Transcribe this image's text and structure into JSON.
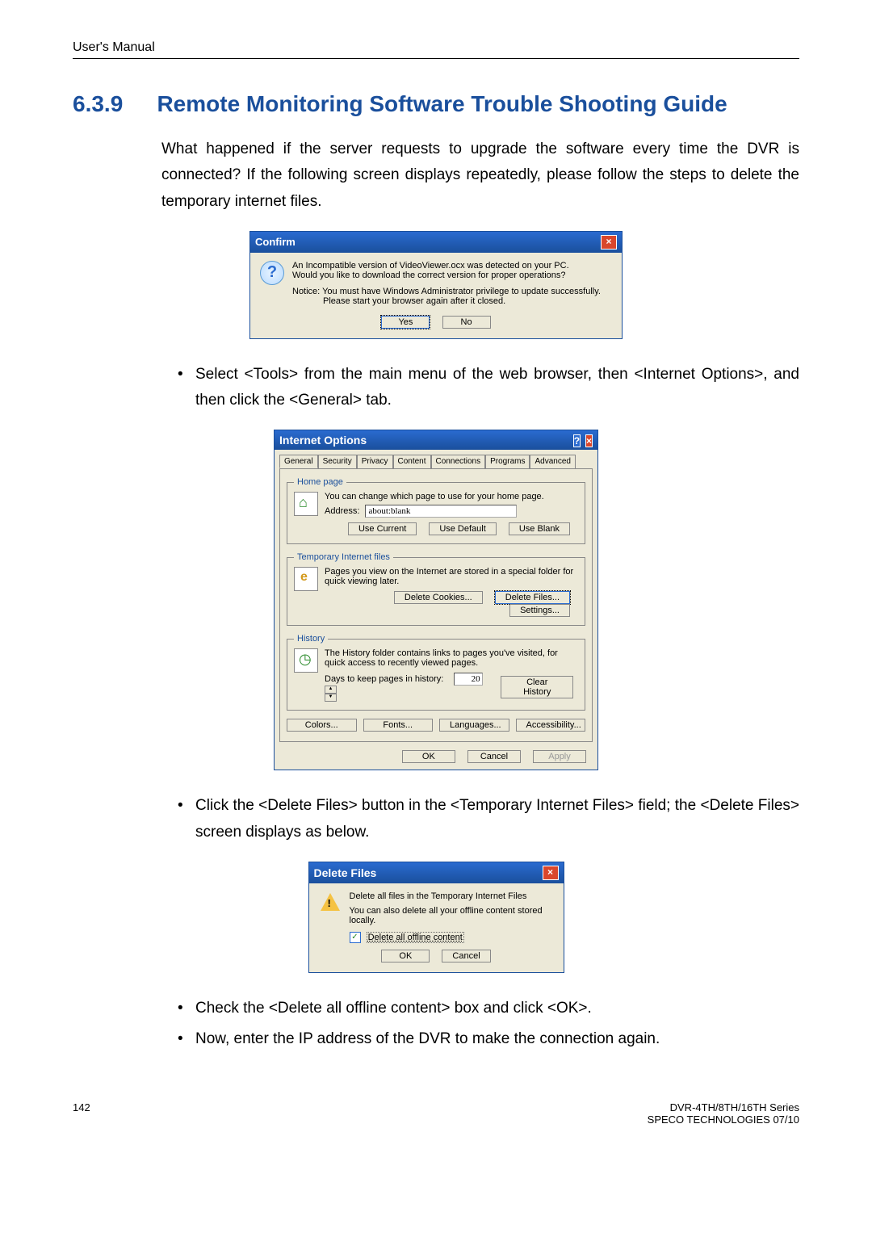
{
  "header": "User's Manual",
  "section": {
    "num": "6.3.9",
    "title": "Remote Monitoring Software Trouble Shooting Guide"
  },
  "para1": "What happened if the server requests to upgrade the software every time the DVR is connected? If the following screen displays repeatedly, please follow the steps to delete the temporary internet files.",
  "confirm": {
    "title": "Confirm",
    "line1": "An Incompatible version of VideoViewer.ocx was detected on your PC.",
    "line2": "Would you like to download the correct version for proper operations?",
    "notice_label": "Notice:",
    "notice1": "You must have Windows Administrator privilege to update successfully.",
    "notice2": "Please start your browser again after it closed.",
    "yes": "Yes",
    "no": "No"
  },
  "step1": "Select <Tools> from the main menu of the web browser, then <Internet Options>, and then click the <General> tab.",
  "io": {
    "title": "Internet Options",
    "tabs": [
      "General",
      "Security",
      "Privacy",
      "Content",
      "Connections",
      "Programs",
      "Advanced"
    ],
    "home": {
      "legend": "Home page",
      "desc": "You can change which page to use for your home page.",
      "addr_label": "Address:",
      "addr_value": "about:blank",
      "use_current": "Use Current",
      "use_default": "Use Default",
      "use_blank": "Use Blank"
    },
    "temp": {
      "legend": "Temporary Internet files",
      "desc": "Pages you view on the Internet are stored in a special folder for quick viewing later.",
      "del_cookies": "Delete Cookies...",
      "del_files": "Delete Files...",
      "settings": "Settings..."
    },
    "hist": {
      "legend": "History",
      "desc": "The History folder contains links to pages you've visited, for quick access to recently viewed pages.",
      "days_label": "Days to keep pages in history:",
      "days_val": "20",
      "clear": "Clear History"
    },
    "btns": {
      "colors": "Colors...",
      "fonts": "Fonts...",
      "languages": "Languages...",
      "access": "Accessibility..."
    },
    "footer": {
      "ok": "OK",
      "cancel": "Cancel",
      "apply": "Apply"
    }
  },
  "step2": "Click the <Delete Files> button in the <Temporary Internet Files> field; the <Delete Files> screen displays as below.",
  "df": {
    "title": "Delete Files",
    "line1": "Delete all files in the Temporary Internet Files",
    "line2": "You can also delete all your offline content stored locally.",
    "chk": "Delete all offline content",
    "ok": "OK",
    "cancel": "Cancel"
  },
  "step3": "Check the <Delete all offline content> box and click <OK>.",
  "step4": "Now, enter the IP address of the DVR to make the connection again.",
  "footer": {
    "page": "142",
    "right1": "DVR-4TH/8TH/16TH Series",
    "right2": "SPECO TECHNOLOGIES 07/10"
  }
}
